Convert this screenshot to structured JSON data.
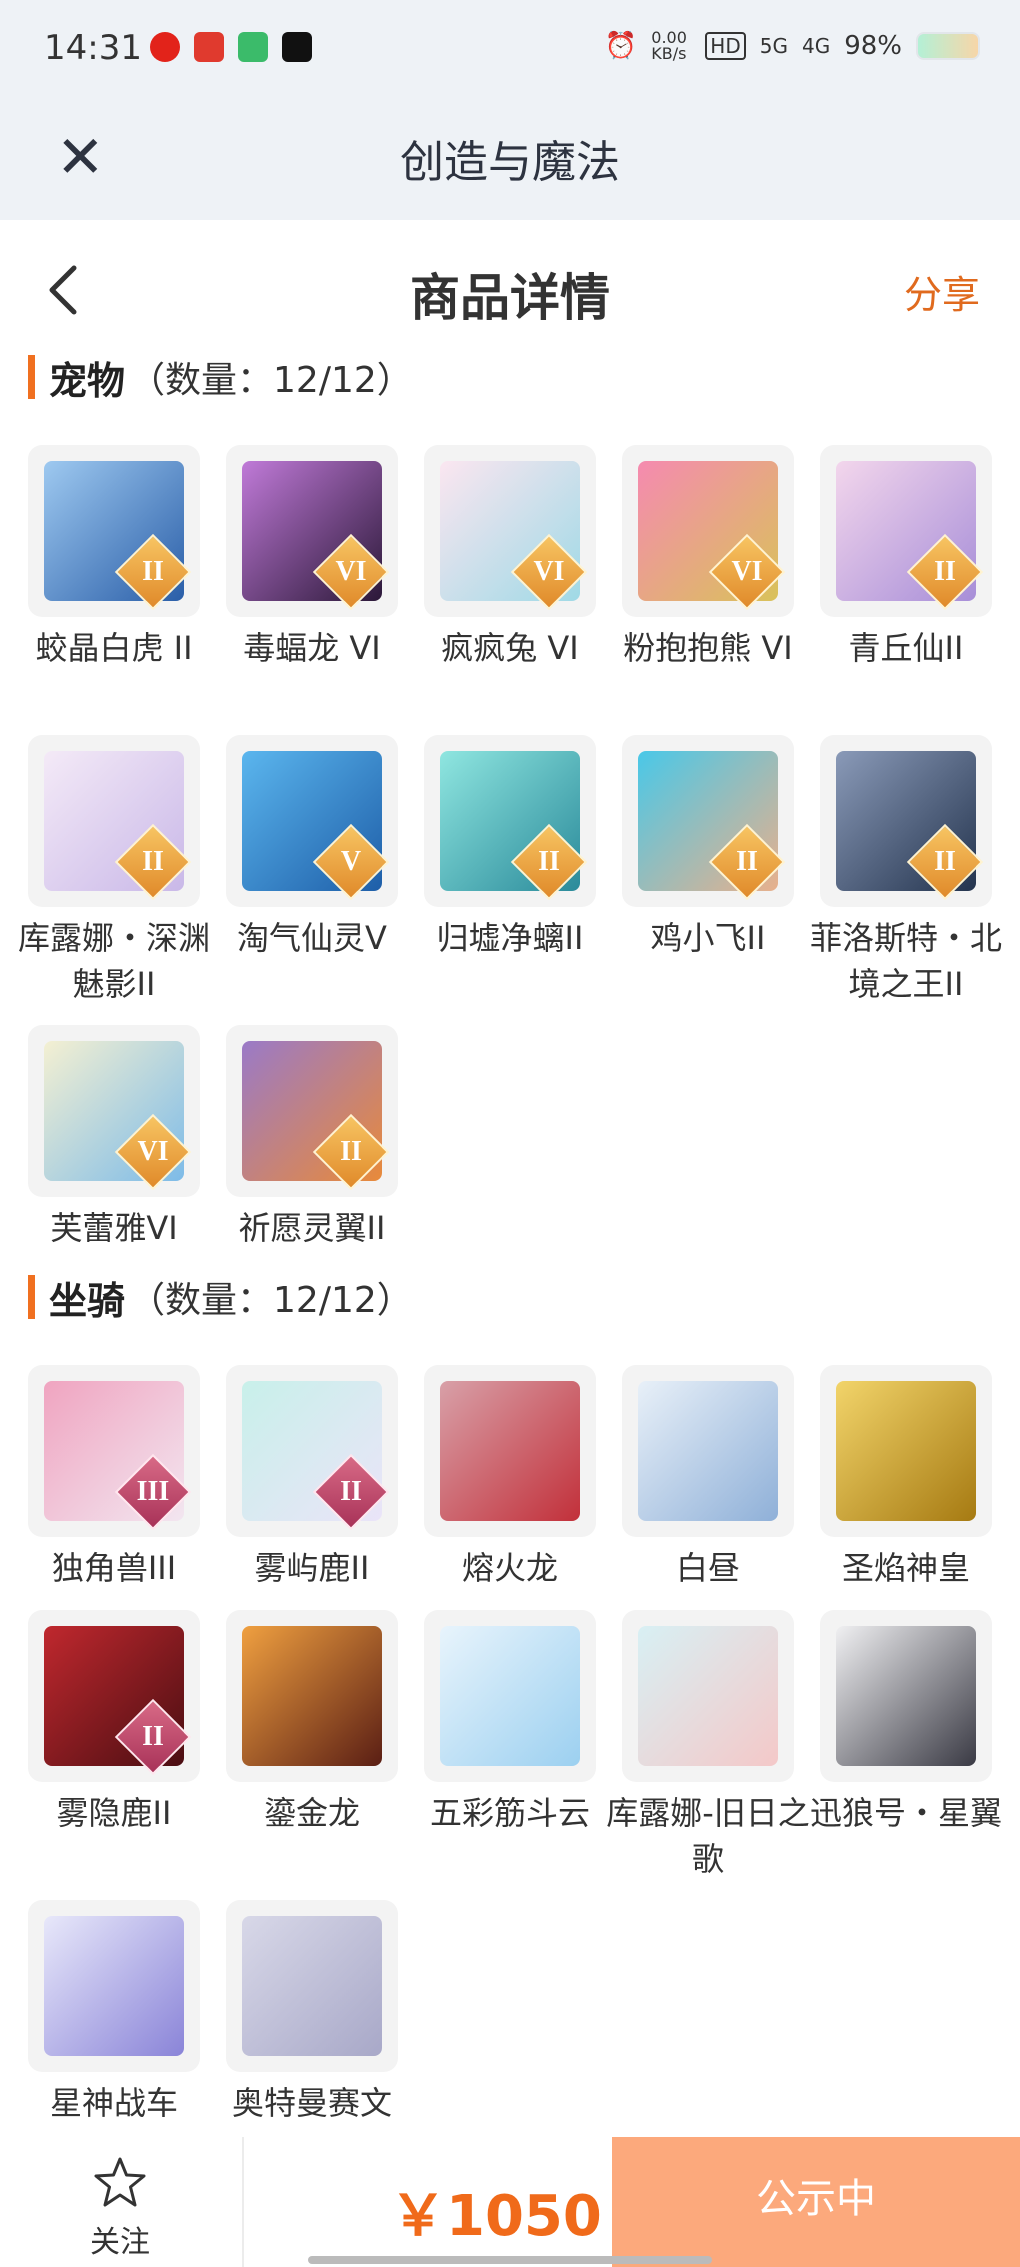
{
  "status": {
    "time": "14:31",
    "net_speed": "0.00 KB/s",
    "hd": "HD",
    "signal_5g": "5G",
    "signal_4g": "4G",
    "battery": "98%"
  },
  "app_title": "创造与魔法",
  "nav": {
    "title": "商品详情",
    "share": "分享"
  },
  "pets": {
    "label": "宠物",
    "count": "（数量：12/12）",
    "items": [
      {
        "name": "蛟晶白虎 II",
        "badge": "II"
      },
      {
        "name": "毒蝠龙 VI",
        "badge": "VI"
      },
      {
        "name": "疯疯兔 VI",
        "badge": "VI"
      },
      {
        "name": "粉抱抱熊 VI",
        "badge": "VI"
      },
      {
        "name": "青丘仙II",
        "badge": "II"
      },
      {
        "name": "库露娜・深渊魅影II",
        "badge": "II"
      },
      {
        "name": "淘气仙灵V",
        "badge": "V"
      },
      {
        "name": "归墟净螭II",
        "badge": "II"
      },
      {
        "name": "鸡小飞II",
        "badge": "II"
      },
      {
        "name": "菲洛斯特・北境之王II",
        "badge": "II"
      },
      {
        "name": "芙蕾雅VI",
        "badge": "VI"
      },
      {
        "name": "祈愿灵翼II",
        "badge": "II"
      }
    ]
  },
  "mounts": {
    "label": "坐骑",
    "count": "（数量：12/12）",
    "items": [
      {
        "name": "独角兽III",
        "badge": "III"
      },
      {
        "name": "雾屿鹿II",
        "badge": "II"
      },
      {
        "name": "熔火龙",
        "badge": ""
      },
      {
        "name": "白昼",
        "badge": ""
      },
      {
        "name": "圣焰神皇",
        "badge": ""
      },
      {
        "name": "雾隐鹿II",
        "badge": "II"
      },
      {
        "name": "鎏金龙",
        "badge": ""
      },
      {
        "name": "五彩筋斗云",
        "badge": ""
      },
      {
        "name": "库露娜-旧日之歌",
        "badge": ""
      },
      {
        "name": "迅狼号・星翼",
        "badge": ""
      },
      {
        "name": "星神战车",
        "badge": ""
      },
      {
        "name": "奥特曼赛文",
        "badge": ""
      }
    ]
  },
  "bottom": {
    "follow": "关注",
    "price": "￥1050",
    "publish": "公示中"
  },
  "colors": {
    "accent": "#f07020",
    "price": "#f06a1a",
    "publish_bg": "#fca97c"
  }
}
